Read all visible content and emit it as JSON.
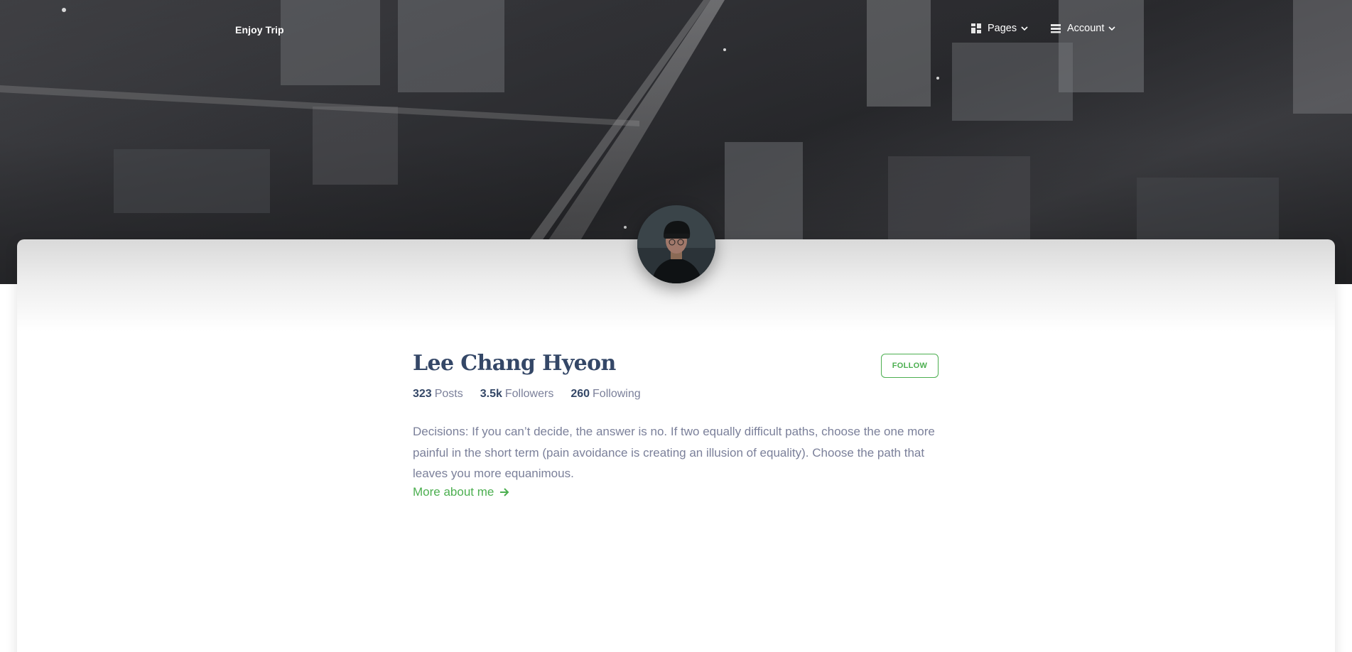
{
  "navbar": {
    "brand": "Enjoy Trip",
    "items": [
      {
        "label": "Pages",
        "icon": "dashboard-icon"
      },
      {
        "label": "Account",
        "icon": "list-icon"
      }
    ]
  },
  "hero": {
    "image": "city-skyline-background"
  },
  "profile": {
    "avatar_icon": "user-avatar",
    "name": "Lee Chang Hyeon",
    "follow_label": "FOLLOW",
    "stats": [
      {
        "value": "323",
        "label": "Posts"
      },
      {
        "value": "3.5k",
        "label": "Followers"
      },
      {
        "value": "260",
        "label": "Following"
      }
    ],
    "bio": "Decisions: If you can’t decide, the answer is no. If two equally difficult paths, choose the one more painful in the short term (pain avoidance is creating an illusion of equality). Choose the path that leaves you more equanimous.",
    "more_link": "More about me",
    "more_link_icon": "arrow-right-icon"
  },
  "colors": {
    "accent": "#4caf50",
    "heading": "#344767",
    "body_text": "#7b809a",
    "hero_overlay": "#2a2b2e"
  }
}
